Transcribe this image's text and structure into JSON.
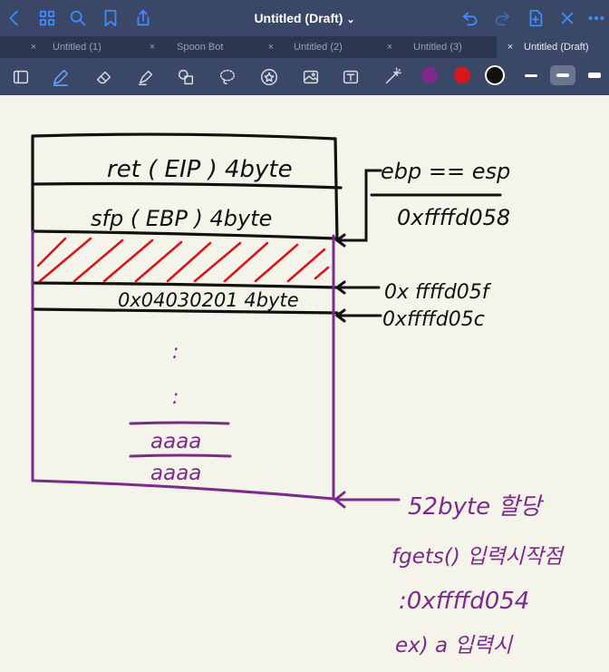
{
  "app": {
    "title": "Untitled (Draft)",
    "title_chevron": "⌄"
  },
  "tabs": [
    {
      "label": "Untitled (1)",
      "close": "×",
      "active": false
    },
    {
      "label": "Spoon Bot",
      "close": "×",
      "active": false
    },
    {
      "label": "Untitled (2)",
      "close": "×",
      "active": false
    },
    {
      "label": "Untitled (3)",
      "close": "×",
      "active": false
    },
    {
      "label": "Untitled (Draft)",
      "close": "×",
      "active": true
    }
  ],
  "colors": {
    "titlebar": "#3a4766",
    "accent": "#3d8bff",
    "swatch_purple": "#7e2a8c",
    "swatch_red": "#d8161c",
    "swatch_black": "#111111",
    "ink_black": "#111111",
    "ink_red": "#d8161c",
    "ink_purple": "#7e2a8c"
  },
  "toolbar_icons": [
    "page-sidebar-icon",
    "pen-icon",
    "eraser-icon",
    "highlighter-icon",
    "shapes-icon",
    "lasso-icon",
    "sticker-icon",
    "image-icon",
    "text-icon",
    "laser-pointer-icon"
  ],
  "notes": {
    "stack_ret": "ret ( EIP )  4byte",
    "stack_sfp": "sfp ( EBP )  4byte",
    "stack_value": "0x04030201  4byte",
    "buffer_dots": ":",
    "buffer_a1": "aaaa",
    "buffer_a2": "aaaa",
    "ebp_esp": "ebp == esp",
    "addr_ebp": "0xffffd058",
    "addr_1": "0x ffffd05f",
    "addr_2": "0xffffd05c",
    "alloc": "52byte  할당",
    "fgets": "fgets()  입력시작점",
    "addr_start": ":0xffffd054",
    "example": "ex) a 입력시"
  }
}
